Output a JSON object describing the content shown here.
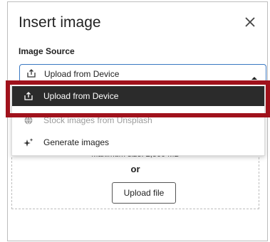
{
  "dialog": {
    "title": "Insert image",
    "close_icon": "close-icon"
  },
  "image_source": {
    "label": "Image Source",
    "selected": "Upload from Device",
    "selected_icon": "upload-icon",
    "caret_icon": "caret-up-icon"
  },
  "menu": {
    "items": [
      {
        "label": "Upload from Device",
        "icon": "upload-icon",
        "highlighted": true
      },
      {
        "label": "Stock images from Unsplash",
        "icon": "globe-icon",
        "highlighted": false
      },
      {
        "label": "Generate images",
        "icon": "sparkle-icon",
        "highlighted": false
      }
    ]
  },
  "dropzone": {
    "max_size_text": "Maximum size: 2,500 MB",
    "or_text": "or",
    "upload_button": "Upload file"
  },
  "colors": {
    "highlight_border": "#a0121c",
    "selected_item_bg": "#2b2b2b",
    "select_border": "#3a78c2"
  }
}
